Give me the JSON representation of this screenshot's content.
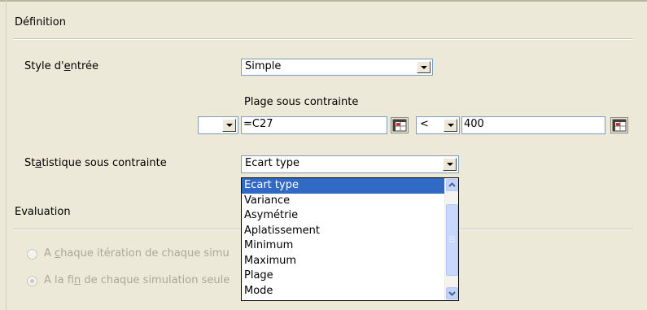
{
  "definition": {
    "section_title": "Définition",
    "style_label": "Style d'entrée",
    "style_value": "Simple",
    "range_label": "Plage sous contrainte",
    "range_prefix_value": "",
    "range_value": "=C27",
    "operator_value": "<",
    "limit_value": "400",
    "stat_label": "Statistique sous contrainte",
    "stat_value": "Ecart type"
  },
  "stat_dropdown": {
    "options": [
      "Ecart type",
      "Variance",
      "Asymétrie",
      "Aplatissement",
      "Minimum",
      "Maximum",
      "Plage",
      "Mode"
    ],
    "selected_index": 0
  },
  "evaluation": {
    "section_title": "Evaluation",
    "option_each_iteration": "A chaque itération de chaque simu",
    "option_end_simulation": "A la fin de chaque simulation seule",
    "selected_option": "end_simulation"
  },
  "colors": {
    "dialog_bg": "#ECE9D8",
    "selection": "#316AC5",
    "field_border": "#7F9DB9",
    "disabled_text": "#ACA899"
  }
}
